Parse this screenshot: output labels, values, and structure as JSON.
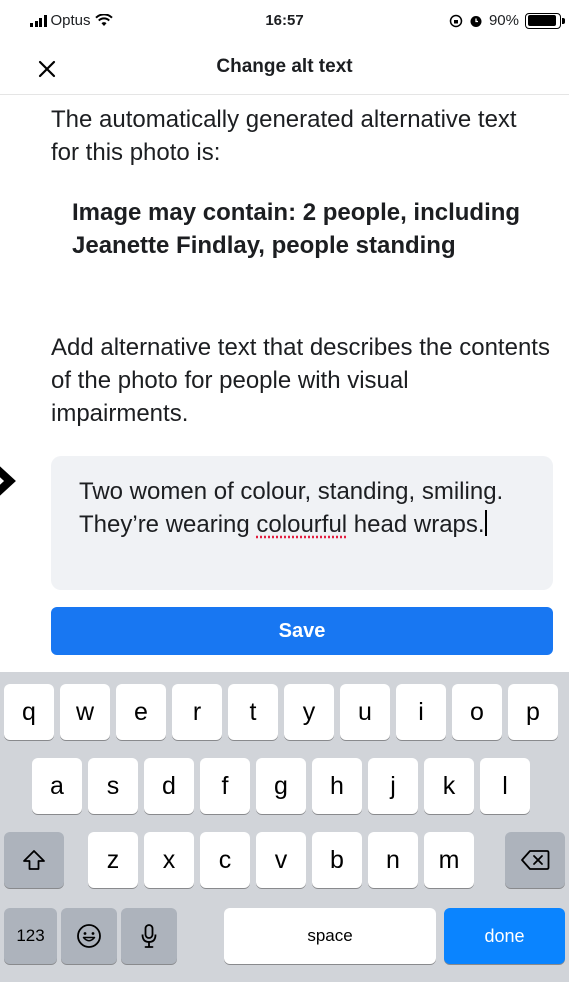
{
  "status_bar": {
    "carrier": "Optus",
    "time": "16:57",
    "battery": "90%"
  },
  "header": {
    "title": "Change alt text",
    "close_icon": "close-icon"
  },
  "content": {
    "intro_text": "The automatically generated alternative text for this photo is:",
    "generated_alt_text": "Image may contain: 2 people, including Jeanette Findlay, people standing",
    "instructions": "Add alternative text that describes the contents of the photo for people with visual impairments.",
    "alt_text_value_part1": "Two women of colour, standing, smiling. They’re wearing ",
    "alt_text_value_misspelled": "colourful",
    "alt_text_value_part2": " head wraps."
  },
  "save_button": {
    "label": "Save",
    "color": "#1877f2"
  },
  "keyboard": {
    "row1": [
      "q",
      "w",
      "e",
      "r",
      "t",
      "y",
      "u",
      "i",
      "o",
      "p"
    ],
    "row2": [
      "a",
      "s",
      "d",
      "f",
      "g",
      "h",
      "j",
      "k",
      "l"
    ],
    "row3": [
      "z",
      "x",
      "c",
      "v",
      "b",
      "n",
      "m"
    ],
    "numbers_label": "123",
    "space_label": "space",
    "done_label": "done",
    "shift_icon": "shift-icon",
    "backspace_icon": "backspace-icon",
    "emoji_icon": "emoji-icon",
    "mic_icon": "microphone-icon"
  }
}
